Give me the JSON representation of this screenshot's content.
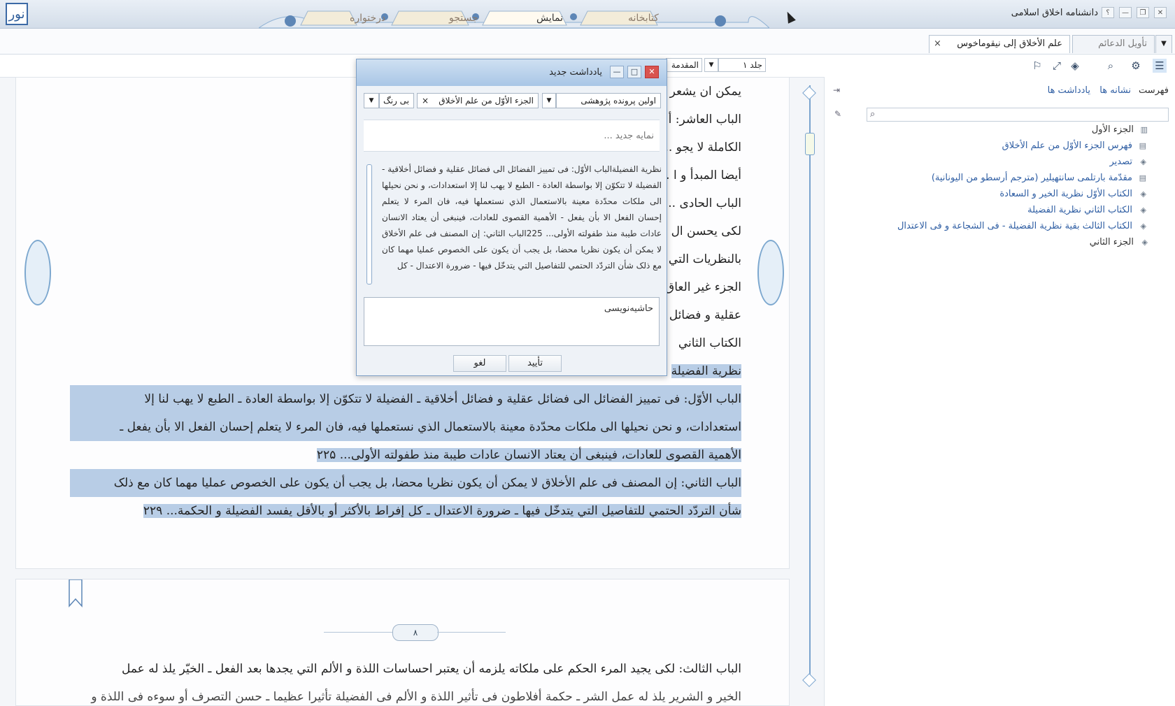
{
  "app": {
    "title": "دانشنامه اخلاق اسلامی",
    "logo": "نور"
  },
  "window_controls": {
    "help": "؟",
    "minimize": "—",
    "restore": "❐",
    "close": "✕"
  },
  "ribbon_tabs": [
    {
      "label": "کتابخانه"
    },
    {
      "label": "نمایش"
    },
    {
      "label": "جستجو"
    },
    {
      "label": "درختواره"
    }
  ],
  "doc_tabs": [
    {
      "label": "علم الأخلاق إلی نیقوماخوس",
      "close": "×"
    },
    {
      "label": "تأویل الدعائم"
    }
  ],
  "toolbar": {
    "volume": "جلد ۱",
    "section": "المقدمة"
  },
  "reader": {
    "lines": [
      {
        "text": "یمکن ان یشعر ... ان تکون قلیلة الحدّة... ۲۱۴",
        "hl": false
      },
      {
        "text": "الباب العاشر: أ ... أشیاء التي یمکن مدحها هو دائما إضافی و تبعی ـ الأشیاء",
        "hl": false
      },
      {
        "text": "الکاملة لا یجو ... س» البدیعة علی اللذة ـ السعادة تستوجب احترامنا، لأنها",
        "hl": false
      },
      {
        "text": "أیضا المبدأ و ا ... ۲۱",
        "hl": false
      },
      {
        "text": "الباب الحادی ... ـ الفضیلة هی الموضوع الأصلی لأعمال الرجل السیاسی ـ",
        "hl": false
      },
      {
        "text": "لکی یحسن ال ... الحدود التي ینبغی أن تحدّ بها هذه الدراسة ـ الاستشهاد",
        "hl": false
      },
      {
        "text": "بالنظریات التي ... ان فی النفس أحدهما غیر عاقل و الثاني ذو عقل ـ تقسیم",
        "hl": false
      },
      {
        "text": "الجزء غیر العاق ... ع العقل و ان کان لا عقل له ـ تقسیم الفضائل الی فضائل",
        "hl": false
      },
      {
        "text": "عقلیة و فضائل",
        "hl": false
      },
      {
        "text": "الکتاب الثاني",
        "hl": false
      },
      {
        "text": "نظریة الفضیلة",
        "hl": true
      },
      {
        "text": "الباب الأوّل: فی تمییز الفضائل الی فضائل عقلیة و فضائل أخلاقیة ـ الفضیلة لا تتکوّن إلا بواسطة العادة ـ الطبع لا یهب لنا إلا",
        "hl": true
      },
      {
        "text": "استعدادات، و نحن نحیلها الی ملکات محدّدة معینة بالاستعمال الذي نستعملها فیه، فان المرء لا یتعلم إحسان الفعل الا بأن یفعل ـ",
        "hl": true
      },
      {
        "text": "الأهمیة القصوی للعادات، فینبغی أن یعتاد الانسان عادات طیبة منذ طفولته الأولی... ۲۲۵",
        "hl": true
      },
      {
        "text": "الباب الثاني: إن المصنف فی علم الأخلاق لا یمکن أن یکون نظریا محضا، بل یجب أن یکون علی الخصوص عملیا مهما کان مع ذلک",
        "hl": true
      },
      {
        "text": "شأن التردّد الحتمي للتفاصیل التي یتدخّل فیها ـ ضرورة الاعتدال ـ کل إفراط بالأکثر أو بالأقل یفسد الفضیلة و الحکمة... ۲۲۹",
        "hl": true
      }
    ],
    "page_number": "۸",
    "page2_line1": "الباب الثالث: لکی یجید المرء الحکم علی ملکاته یلزمه أن یعتبر احساسات اللذة و الألم التي یجدها بعد الفعل ـ الخیّر یلذ له عمل",
    "page2_line2": "الخیر و الشریر یلذ له عمل الشر ـ حکمة أفلاطون فی تأثیر اللذة و الألم فی الفضیلة تأثیرا عظیما ـ حسن التصرف أو سوءه فی اللذة و"
  },
  "right_panel": {
    "tabs": [
      "فهرست",
      "نشانه ها",
      "یادداشت ها"
    ],
    "search_placeholder": "",
    "tree": [
      {
        "label": "الجزء الأول",
        "type": "root",
        "icon": "book-icon"
      },
      {
        "label": "فهرس الجزء الأوّل من علم الأخلاق",
        "type": "link",
        "icon": "page-icon"
      },
      {
        "label": "تصدیر",
        "type": "link",
        "icon": "layers-icon"
      },
      {
        "label": "مقدّمة بارتلمی سانتهیلیر (مترجم أرسطو من الیونانیة)",
        "type": "link",
        "icon": "page-icon"
      },
      {
        "label": "الکتاب الأوّل نظریة الخیر و السعادة",
        "type": "link",
        "icon": "layers-icon"
      },
      {
        "label": "الکتاب الثاني نظریة الفضیلة",
        "type": "link",
        "icon": "layers-icon"
      },
      {
        "label": "الکتاب الثالث بقیة نظریة الفضیلة - فی الشجاعة و فی الاعتدال",
        "type": "link",
        "icon": "layers-icon"
      },
      {
        "label": "الجزء الثاني",
        "type": "root",
        "icon": "layers-icon"
      }
    ]
  },
  "dialog": {
    "title": "یادداشت جدید",
    "combo_folder": "اولین پرونده پژوهشی",
    "combo_source": "الجزء الأوّل من علم الأخلاق",
    "combo_color": "بی رنگ",
    "new_placeholder": "نمایه جدید ...",
    "quote": "نظریة الفضیلةالباب الأوّل: فی تمییز الفضائل الی فضائل عقلیة و فضائل أخلاقیة - الفضیلة لا تتکوّن إلا بواسطة العادة - الطبع لا یهب لنا إلا استعدادات، و نحن نحیلها الی ملکات محدّدة معینة بالاستعمال الذي نستعملها فیه، فان المرء لا یتعلم إحسان الفعل الا بأن یفعل - الأهمیة القصوی للعادات، فینبغی أن یعتاد الانسان عادات طیبة منذ طفولته الأولی... 225الباب الثاني: إن المصنف فی علم الأخلاق لا یمکن أن یکون نظریا محضا، بل یجب أن یکون علی الخصوص عملیا مهما کان مع ذلک شأن التردّد الحتمي للتفاصیل التي یتدخّل فیها - ضرورة الاعتدال - کل",
    "notes_label": "حاشیه‌نویسی",
    "confirm": "تأیید",
    "cancel": "لغو"
  }
}
